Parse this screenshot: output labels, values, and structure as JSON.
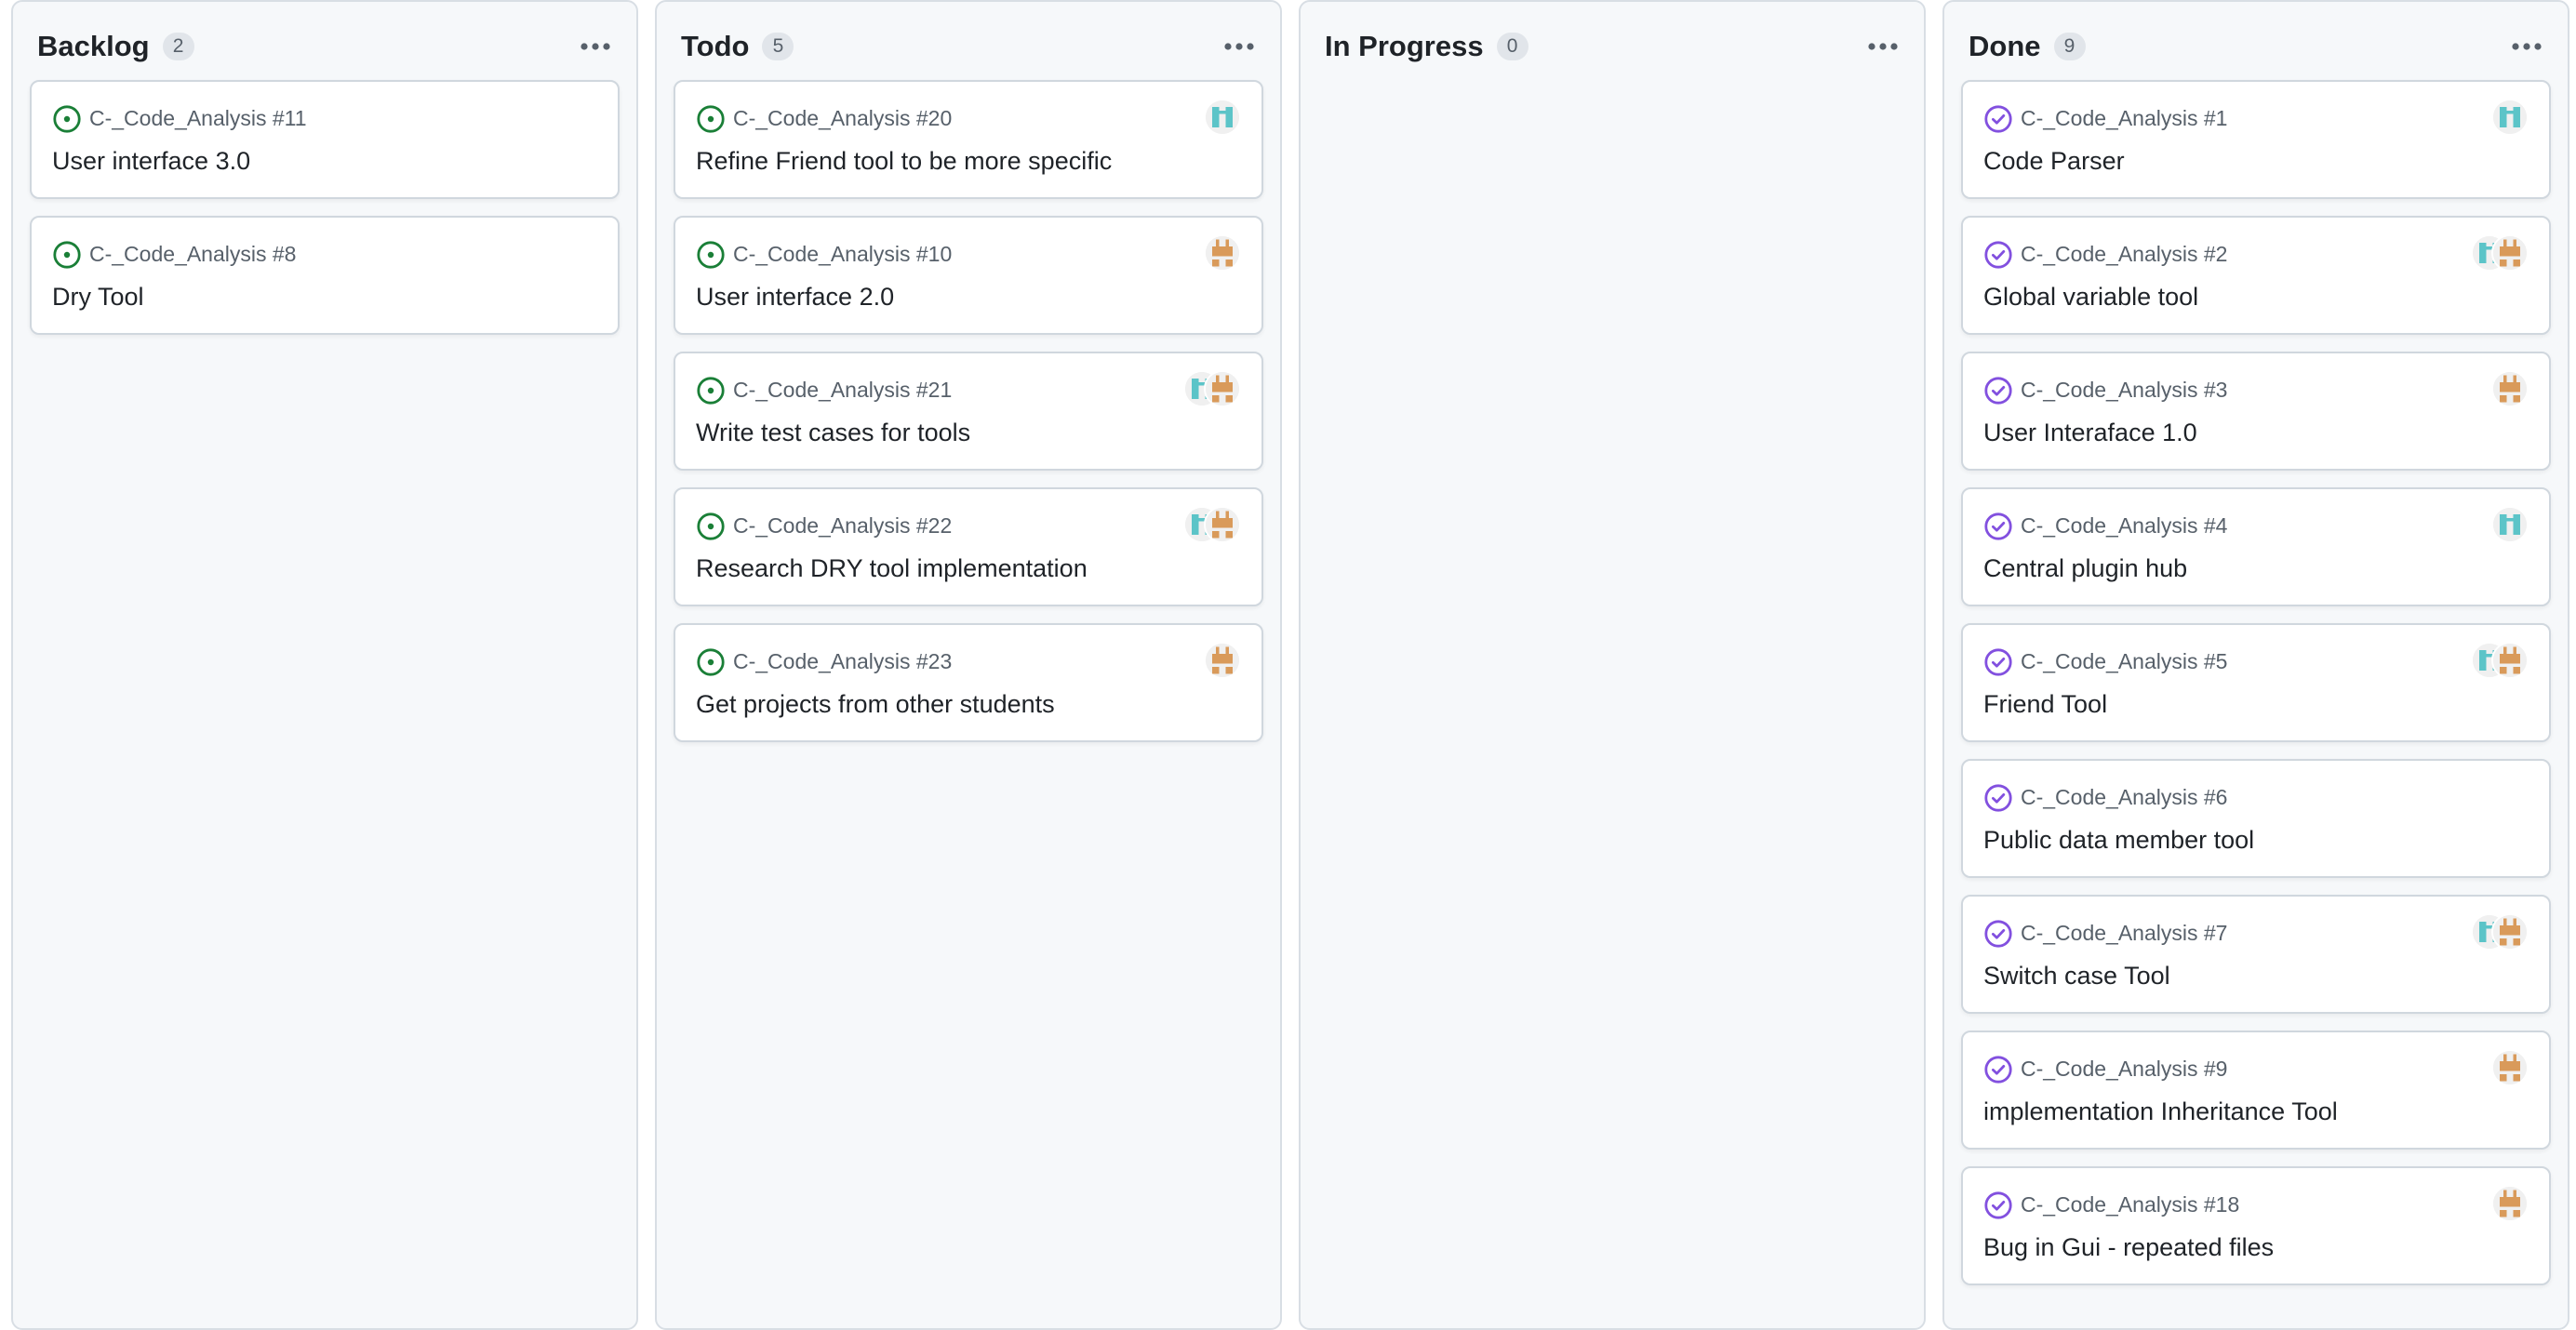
{
  "colors": {
    "open": "#1a7f37",
    "done": "#8250df",
    "avatar_teal": "#5cc4c8",
    "avatar_orange": "#d99a5a"
  },
  "columns": [
    {
      "title": "Backlog",
      "count": "2",
      "cards": [
        {
          "ref": "C-_Code_Analysis #11",
          "title": "User interface 3.0",
          "status": "open",
          "assignees": []
        },
        {
          "ref": "C-_Code_Analysis #8",
          "title": "Dry Tool",
          "status": "open",
          "assignees": []
        }
      ]
    },
    {
      "title": "Todo",
      "count": "5",
      "cards": [
        {
          "ref": "C-_Code_Analysis #20",
          "title": "Refine Friend tool to be more specific",
          "status": "open",
          "assignees": [
            "teal"
          ]
        },
        {
          "ref": "C-_Code_Analysis #10",
          "title": "User interface 2.0",
          "status": "open",
          "assignees": [
            "orange"
          ]
        },
        {
          "ref": "C-_Code_Analysis #21",
          "title": "Write test cases for tools",
          "status": "open",
          "assignees": [
            "teal",
            "orange"
          ]
        },
        {
          "ref": "C-_Code_Analysis #22",
          "title": "Research DRY tool implementation",
          "status": "open",
          "assignees": [
            "teal",
            "orange"
          ]
        },
        {
          "ref": "C-_Code_Analysis #23",
          "title": "Get projects from other students",
          "status": "open",
          "assignees": [
            "orange"
          ]
        }
      ]
    },
    {
      "title": "In Progress",
      "count": "0",
      "cards": []
    },
    {
      "title": "Done",
      "count": "9",
      "cards": [
        {
          "ref": "C-_Code_Analysis #1",
          "title": "Code Parser",
          "status": "done",
          "assignees": [
            "teal"
          ]
        },
        {
          "ref": "C-_Code_Analysis #2",
          "title": "Global variable tool",
          "status": "done",
          "assignees": [
            "teal",
            "orange"
          ]
        },
        {
          "ref": "C-_Code_Analysis #3",
          "title": "User Interaface 1.0",
          "status": "done",
          "assignees": [
            "orange"
          ]
        },
        {
          "ref": "C-_Code_Analysis #4",
          "title": "Central plugin hub",
          "status": "done",
          "assignees": [
            "teal"
          ]
        },
        {
          "ref": "C-_Code_Analysis #5",
          "title": "Friend Tool",
          "status": "done",
          "assignees": [
            "teal",
            "orange"
          ]
        },
        {
          "ref": "C-_Code_Analysis #6",
          "title": "Public data member tool",
          "status": "done",
          "assignees": []
        },
        {
          "ref": "C-_Code_Analysis #7",
          "title": "Switch case Tool",
          "status": "done",
          "assignees": [
            "teal",
            "orange"
          ]
        },
        {
          "ref": "C-_Code_Analysis #9",
          "title": "implementation Inheritance Tool",
          "status": "done",
          "assignees": [
            "orange"
          ]
        },
        {
          "ref": "C-_Code_Analysis #18",
          "title": "Bug in Gui - repeated files",
          "status": "done",
          "assignees": [
            "orange"
          ]
        }
      ]
    }
  ]
}
